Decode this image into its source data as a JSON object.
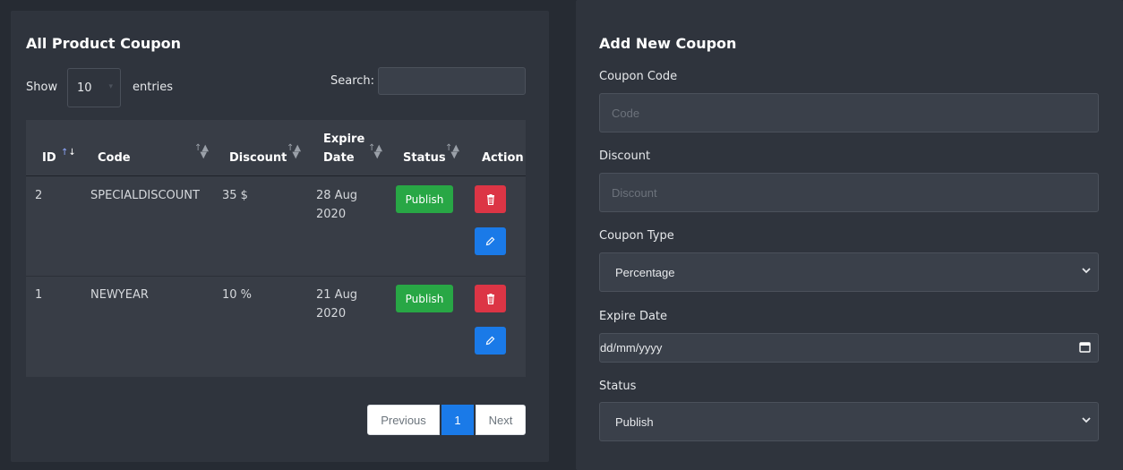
{
  "coupon_list": {
    "title": "All Product Coupon",
    "show_label": "Show",
    "entries_value": "10",
    "entries_label": "entries",
    "search_label": "Search:",
    "columns": [
      "ID",
      "Code",
      "Discount",
      "Expire",
      "Date",
      "Status",
      "Action"
    ],
    "rows": [
      {
        "id": "2",
        "code": "SPECIALDISCOUNT",
        "discount": "35 $",
        "expire_line1": "28 Aug",
        "expire_line2": "2020",
        "status": "Publish"
      },
      {
        "id": "1",
        "code": "NEWYEAR",
        "discount": "10 %",
        "expire_line1": "21 Aug",
        "expire_line2": "2020",
        "status": "Publish"
      }
    ],
    "pagination": {
      "previous": "Previous",
      "current": "1",
      "next": "Next"
    }
  },
  "add_coupon": {
    "title": "Add New Coupon",
    "code_label": "Coupon Code",
    "code_placeholder": "Code",
    "discount_label": "Discount",
    "discount_placeholder": "Discount",
    "type_label": "Coupon Type",
    "type_value": "Percentage",
    "expire_label": "Expire Date",
    "expire_value": "dd/mm/yyyy",
    "status_label": "Status",
    "status_value": "Publish"
  },
  "colors": {
    "publish": "#28a745",
    "delete": "#dc3545",
    "edit": "#1a7ae8",
    "page_active": "#1a7ae8"
  }
}
